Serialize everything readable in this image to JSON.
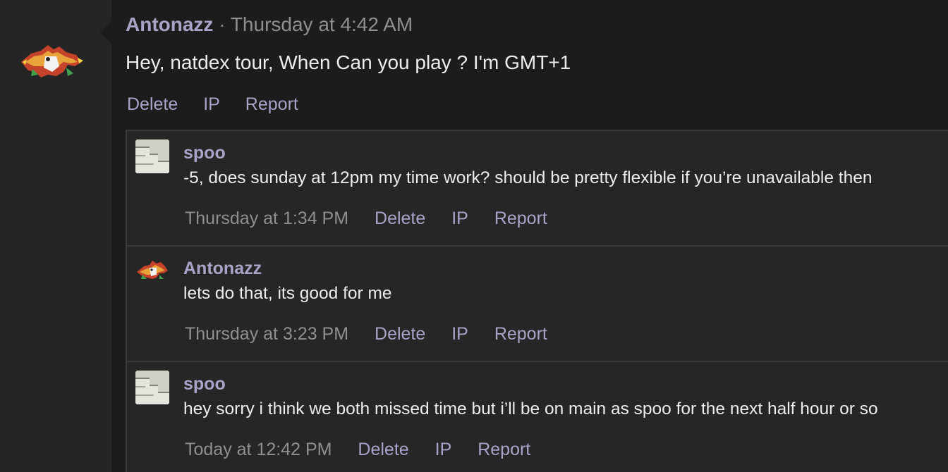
{
  "message": {
    "author": "Antonazz",
    "separator": "·",
    "timestamp": "Thursday at 4:42 AM",
    "text": "Hey, natdex tour, When Can you play ? I'm GMT+1",
    "actions": [
      "Delete",
      "IP",
      "Report"
    ]
  },
  "comments": [
    {
      "author": "spoo",
      "avatar": "stairs-avatar",
      "text": "-5, does sunday at 12pm my time work? should be pretty flexible if you’re unavailable then",
      "timestamp": "Thursday at 1:34 PM",
      "actions": [
        "Delete",
        "IP",
        "Report"
      ]
    },
    {
      "author": "Antonazz",
      "avatar": "bird-avatar",
      "text": "lets do that, its good for me",
      "timestamp": "Thursday at 3:23 PM",
      "actions": [
        "Delete",
        "IP",
        "Report"
      ]
    },
    {
      "author": "spoo",
      "avatar": "stairs-avatar",
      "text": "hey sorry i think we both missed time but i’ll be on main as spoo for the next half hour or so",
      "timestamp": "Today at 12:42 PM",
      "actions": [
        "Delete",
        "IP",
        "Report"
      ]
    }
  ],
  "colors": {
    "accent": "#a9a3c8",
    "text": "#ececec",
    "muted": "#8f8f8f",
    "background": "#1c1c1c",
    "comment_background": "#262626"
  }
}
